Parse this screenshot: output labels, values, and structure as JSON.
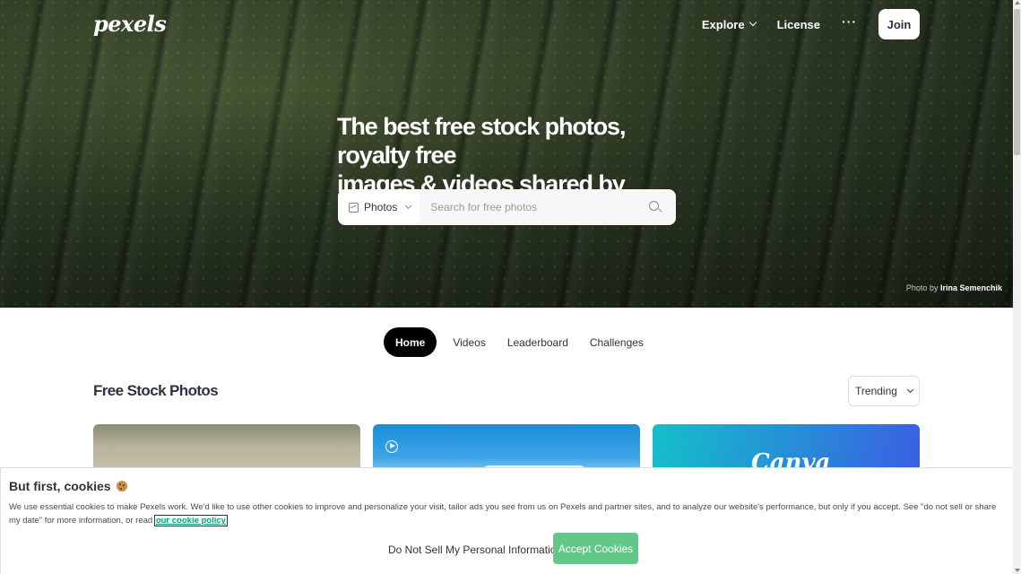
{
  "header": {
    "logo": "pexels",
    "nav": [
      {
        "label": "Explore"
      },
      {
        "label": "License"
      },
      {
        "label": "···"
      }
    ],
    "join_label": "Join"
  },
  "hero": {
    "title_line1": "The best free stock photos, royalty free",
    "title_line2": "images & videos shared by creators.",
    "search": {
      "type_label": "Photos",
      "placeholder": "Search for free photos",
      "type_icon": "image-icon",
      "search_icon": "search-icon"
    },
    "credit_prefix": "Photo by",
    "credit_name": "Irina Semenchik"
  },
  "tabs": [
    {
      "label": "Home",
      "active": true
    },
    {
      "label": "Videos",
      "active": false
    },
    {
      "label": "Leaderboard",
      "active": false
    },
    {
      "label": "Challenges",
      "active": false
    }
  ],
  "main": {
    "section_title": "Free Stock Photos",
    "sort_label": "Trending"
  },
  "cards": [
    {
      "kind": "photo"
    },
    {
      "kind": "video",
      "icon": "play-circle-icon"
    },
    {
      "kind": "ad",
      "brand": "Canva"
    }
  ],
  "cookie": {
    "title": "But first, cookies",
    "body": "We use essential cookies to make Pexels work. We'd like to use other cookies to improve and personalize your visit, tailor ads you see from us on Pexels and partner sites, and to analyze our website's performance, but only if you accept. See \"do not sell or share my date\" for more information, or read",
    "link_label": "our cookie policy",
    "dns_label": "Do Not Sell My Personal Information",
    "accept_label": "Accept Cookies"
  },
  "colors": {
    "accept_green": "#63c787",
    "link_teal": "#05a081",
    "text_dark": "#2c343e"
  }
}
